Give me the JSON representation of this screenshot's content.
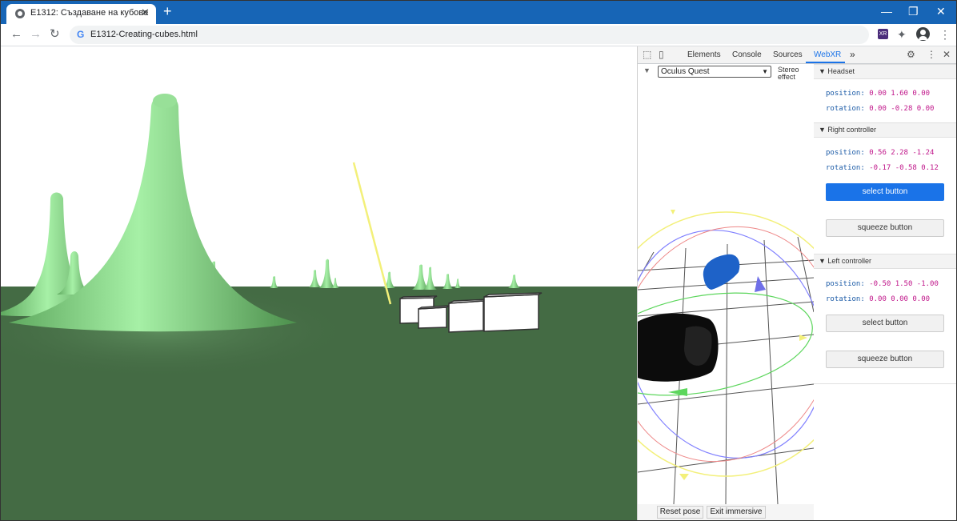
{
  "browser": {
    "tab_title": "E1312: Създаване на кубове",
    "tab_close": "✕",
    "new_tab": "+",
    "url": "E1312-Creating-cubes.html",
    "window": {
      "minimize": "—",
      "maximize": "❐",
      "close": "✕"
    },
    "nav": {
      "back": "←",
      "forward": "→",
      "reload": "↻"
    },
    "menu": "⋮",
    "extensions": "✦",
    "xr_ext": "XR"
  },
  "devtools": {
    "tabs": [
      "Elements",
      "Console",
      "Sources",
      "WebXR"
    ],
    "active_tab": "WebXR",
    "more": "»",
    "settings": "⚙",
    "menu": "⋮",
    "close": "✕",
    "webxr": {
      "device": "Oculus Quest",
      "stereo_label": "Stereo effect",
      "reset_pose": "Reset pose",
      "exit_immersive": "Exit immersive",
      "headset": {
        "title": "Headset",
        "position_label": "position:",
        "position": "0.00 1.60 0.00",
        "rotation_label": "rotation:",
        "rotation": "0.00 -0.28 0.00"
      },
      "right_controller": {
        "title": "Right controller",
        "position_label": "position:",
        "position": "0.56 2.28 -1.24",
        "rotation_label": "rotation:",
        "rotation": "-0.17 -0.58 0.12",
        "select_button": "select button",
        "select_pressed": true,
        "squeeze_button": "squeeze button"
      },
      "left_controller": {
        "title": "Left controller",
        "position_label": "position:",
        "position": "-0.50 1.50 -1.00",
        "rotation_label": "rotation:",
        "rotation": "0.00 0.00 0.00",
        "select_button": "select button",
        "squeeze_button": "squeeze button"
      }
    }
  },
  "scene": {
    "ground_color": "#446b44",
    "sky_color": "#ffffff",
    "spike_color": "#8ed88e",
    "ray_color": "#f3f07a"
  }
}
